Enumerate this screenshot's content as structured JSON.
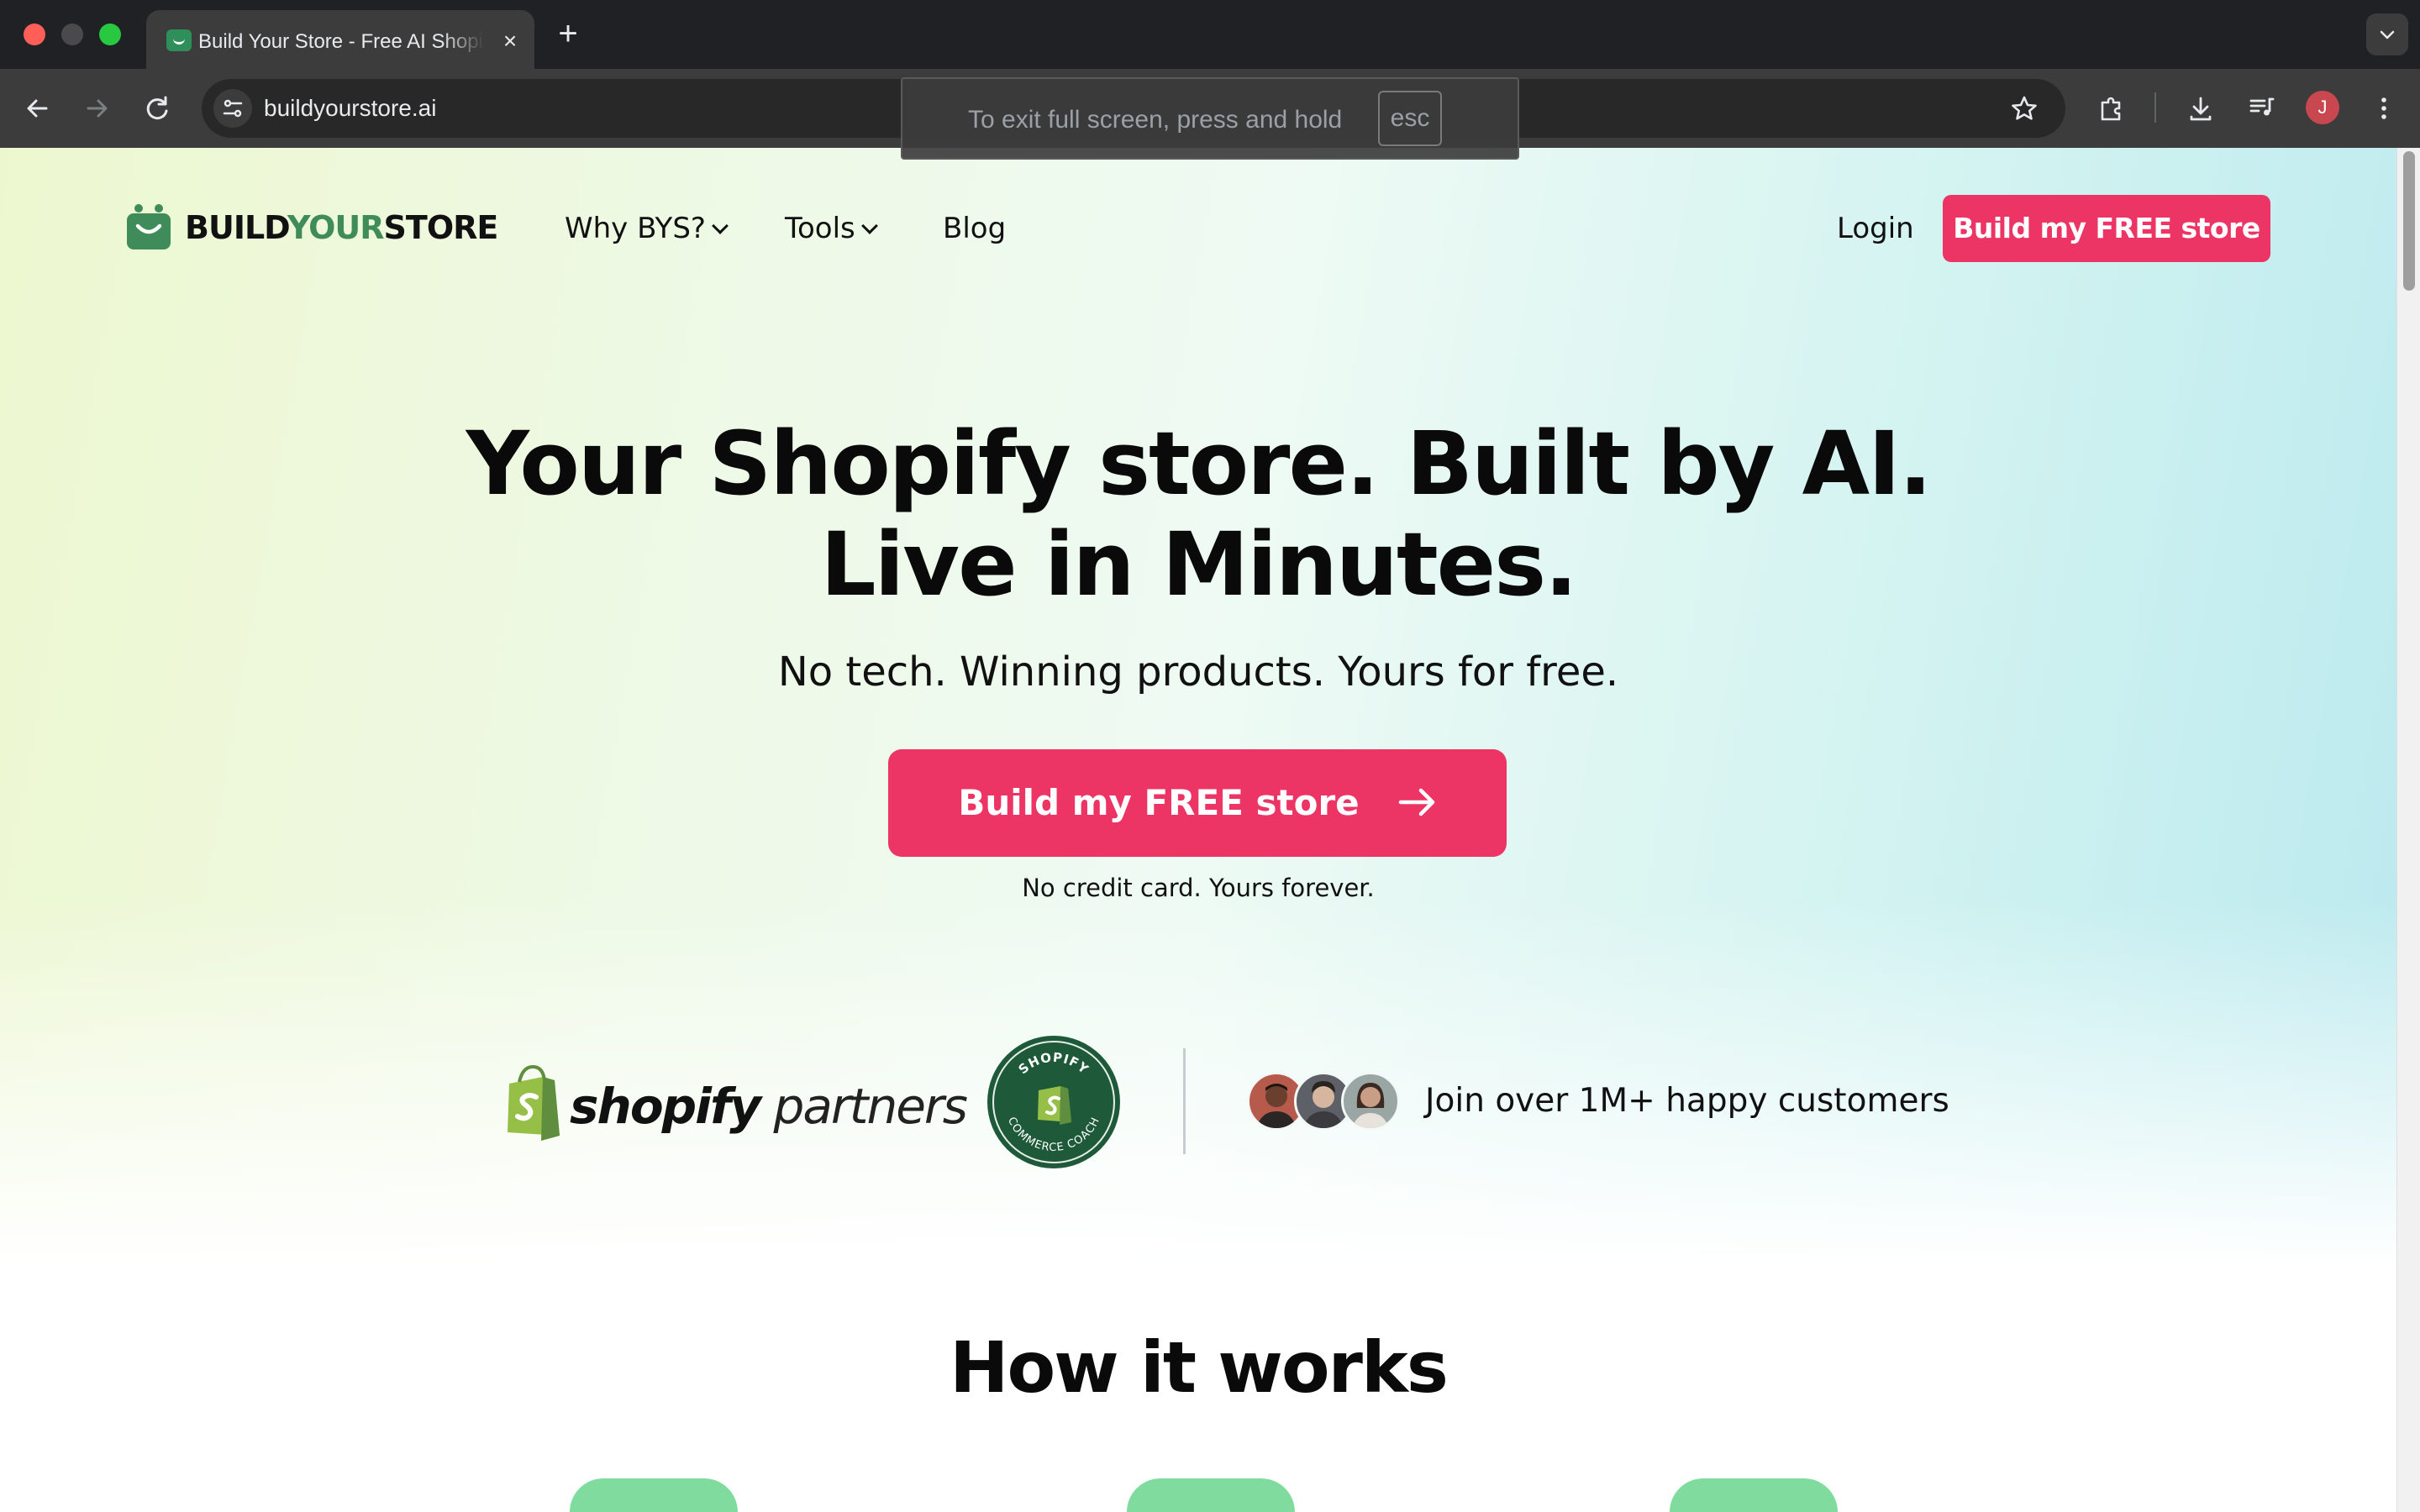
{
  "browser": {
    "tab_title": "Build Your Store - Free AI Shopify Store Builder",
    "url": "buildyourstore.ai",
    "fullscreen_hint": "To exit full screen, press and hold",
    "fullscreen_key": "esc",
    "profile_initial": "J"
  },
  "site": {
    "brand_part1": "BUILD",
    "brand_part2": "YOUR",
    "brand_part3": "STORE",
    "nav": {
      "why": "Why BYS?",
      "tools": "Tools",
      "blog": "Blog",
      "login": "Login",
      "cta": "Build my FREE store"
    },
    "hero": {
      "line1": "Your Shopify store. Built by AI.",
      "line2": "Live in Minutes.",
      "subtitle": "No tech. Winning products. Yours for free.",
      "cta": "Build my FREE store",
      "note": "No credit card. Yours forever."
    },
    "trust": {
      "partners_bold": "shopify",
      "partners_light": "partners",
      "badge_top": "SHOPIFY",
      "badge_bottom": "COMMERCE COACH",
      "customers": "Join over 1M+ happy customers"
    },
    "how_heading": "How it works"
  },
  "colors": {
    "accent": "#ec3564",
    "brand_green": "#3f8c5a",
    "step_green": "#80dc9e"
  }
}
